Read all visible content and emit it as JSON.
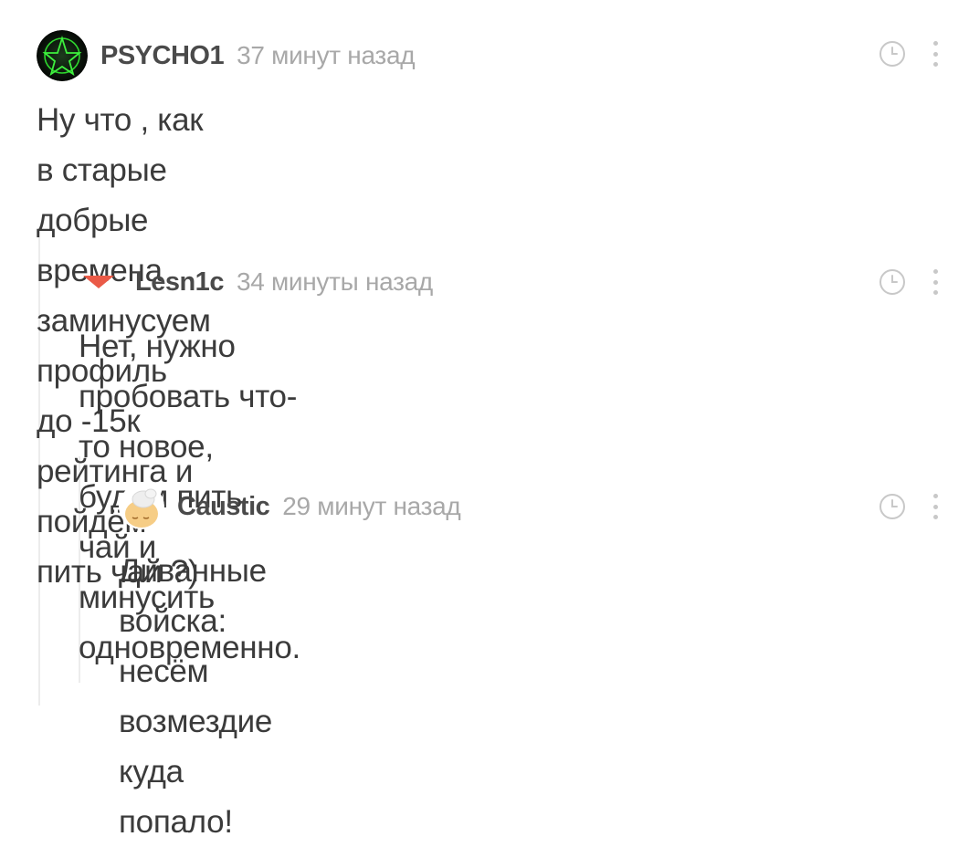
{
  "comments": [
    {
      "username": "PSYCHO1",
      "time": "37 минут назад",
      "text_line1": "Ну что , как в старые добрые времена заминусуем",
      "text_line2": "профиль до -15к рейтинга и пойдём пить чай ?)",
      "avatar_icon": "green-pentagram-avatar"
    },
    {
      "username": "Lesn1c",
      "time": "34 минуты назад",
      "text_line1": "Нет, нужно пробовать что-то новое, будем пить",
      "text_line2": "чай и минусить одновременно.",
      "collapse_icon": "triangle-down-icon"
    },
    {
      "username": "Caustic",
      "time": "29 минут назад",
      "text_line1": "Диванные войска: несём возмездие куда",
      "text_line2": "попало!",
      "avatar_icon": "sleepy-bun-avatar"
    }
  ],
  "colors": {
    "accent_arrow": "#ea5a47",
    "branch_line": "#ececec",
    "username": "#4a4a4a",
    "time": "#a8a8a8",
    "text": "#3b3b3b",
    "icon": "#c8c8c8"
  }
}
